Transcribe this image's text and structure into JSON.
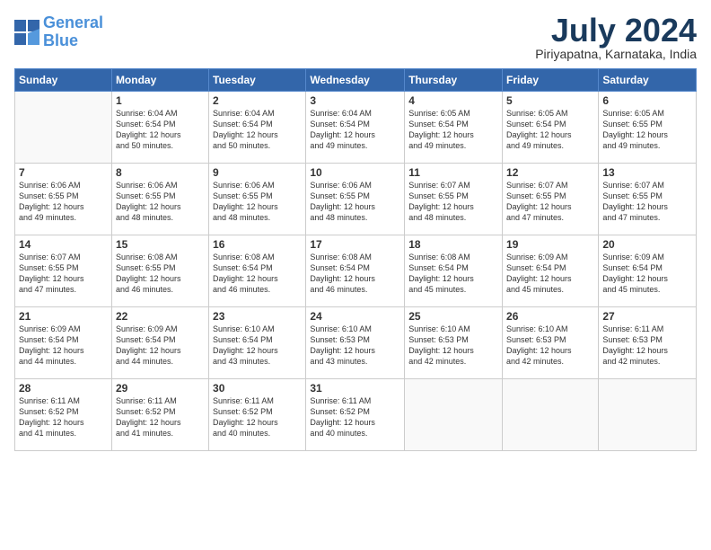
{
  "header": {
    "logo_line1": "General",
    "logo_line2": "Blue",
    "month": "July 2024",
    "location": "Piriyapatna, Karnataka, India"
  },
  "weekdays": [
    "Sunday",
    "Monday",
    "Tuesday",
    "Wednesday",
    "Thursday",
    "Friday",
    "Saturday"
  ],
  "weeks": [
    [
      {
        "day": "",
        "sunrise": "",
        "sunset": "",
        "daylight": ""
      },
      {
        "day": "1",
        "sunrise": "Sunrise: 6:04 AM",
        "sunset": "Sunset: 6:54 PM",
        "daylight": "Daylight: 12 hours and 50 minutes."
      },
      {
        "day": "2",
        "sunrise": "Sunrise: 6:04 AM",
        "sunset": "Sunset: 6:54 PM",
        "daylight": "Daylight: 12 hours and 50 minutes."
      },
      {
        "day": "3",
        "sunrise": "Sunrise: 6:04 AM",
        "sunset": "Sunset: 6:54 PM",
        "daylight": "Daylight: 12 hours and 49 minutes."
      },
      {
        "day": "4",
        "sunrise": "Sunrise: 6:05 AM",
        "sunset": "Sunset: 6:54 PM",
        "daylight": "Daylight: 12 hours and 49 minutes."
      },
      {
        "day": "5",
        "sunrise": "Sunrise: 6:05 AM",
        "sunset": "Sunset: 6:54 PM",
        "daylight": "Daylight: 12 hours and 49 minutes."
      },
      {
        "day": "6",
        "sunrise": "Sunrise: 6:05 AM",
        "sunset": "Sunset: 6:55 PM",
        "daylight": "Daylight: 12 hours and 49 minutes."
      }
    ],
    [
      {
        "day": "7",
        "sunrise": "Sunrise: 6:06 AM",
        "sunset": "Sunset: 6:55 PM",
        "daylight": "Daylight: 12 hours and 49 minutes."
      },
      {
        "day": "8",
        "sunrise": "Sunrise: 6:06 AM",
        "sunset": "Sunset: 6:55 PM",
        "daylight": "Daylight: 12 hours and 48 minutes."
      },
      {
        "day": "9",
        "sunrise": "Sunrise: 6:06 AM",
        "sunset": "Sunset: 6:55 PM",
        "daylight": "Daylight: 12 hours and 48 minutes."
      },
      {
        "day": "10",
        "sunrise": "Sunrise: 6:06 AM",
        "sunset": "Sunset: 6:55 PM",
        "daylight": "Daylight: 12 hours and 48 minutes."
      },
      {
        "day": "11",
        "sunrise": "Sunrise: 6:07 AM",
        "sunset": "Sunset: 6:55 PM",
        "daylight": "Daylight: 12 hours and 48 minutes."
      },
      {
        "day": "12",
        "sunrise": "Sunrise: 6:07 AM",
        "sunset": "Sunset: 6:55 PM",
        "daylight": "Daylight: 12 hours and 47 minutes."
      },
      {
        "day": "13",
        "sunrise": "Sunrise: 6:07 AM",
        "sunset": "Sunset: 6:55 PM",
        "daylight": "Daylight: 12 hours and 47 minutes."
      }
    ],
    [
      {
        "day": "14",
        "sunrise": "Sunrise: 6:07 AM",
        "sunset": "Sunset: 6:55 PM",
        "daylight": "Daylight: 12 hours and 47 minutes."
      },
      {
        "day": "15",
        "sunrise": "Sunrise: 6:08 AM",
        "sunset": "Sunset: 6:55 PM",
        "daylight": "Daylight: 12 hours and 46 minutes."
      },
      {
        "day": "16",
        "sunrise": "Sunrise: 6:08 AM",
        "sunset": "Sunset: 6:54 PM",
        "daylight": "Daylight: 12 hours and 46 minutes."
      },
      {
        "day": "17",
        "sunrise": "Sunrise: 6:08 AM",
        "sunset": "Sunset: 6:54 PM",
        "daylight": "Daylight: 12 hours and 46 minutes."
      },
      {
        "day": "18",
        "sunrise": "Sunrise: 6:08 AM",
        "sunset": "Sunset: 6:54 PM",
        "daylight": "Daylight: 12 hours and 45 minutes."
      },
      {
        "day": "19",
        "sunrise": "Sunrise: 6:09 AM",
        "sunset": "Sunset: 6:54 PM",
        "daylight": "Daylight: 12 hours and 45 minutes."
      },
      {
        "day": "20",
        "sunrise": "Sunrise: 6:09 AM",
        "sunset": "Sunset: 6:54 PM",
        "daylight": "Daylight: 12 hours and 45 minutes."
      }
    ],
    [
      {
        "day": "21",
        "sunrise": "Sunrise: 6:09 AM",
        "sunset": "Sunset: 6:54 PM",
        "daylight": "Daylight: 12 hours and 44 minutes."
      },
      {
        "day": "22",
        "sunrise": "Sunrise: 6:09 AM",
        "sunset": "Sunset: 6:54 PM",
        "daylight": "Daylight: 12 hours and 44 minutes."
      },
      {
        "day": "23",
        "sunrise": "Sunrise: 6:10 AM",
        "sunset": "Sunset: 6:54 PM",
        "daylight": "Daylight: 12 hours and 43 minutes."
      },
      {
        "day": "24",
        "sunrise": "Sunrise: 6:10 AM",
        "sunset": "Sunset: 6:53 PM",
        "daylight": "Daylight: 12 hours and 43 minutes."
      },
      {
        "day": "25",
        "sunrise": "Sunrise: 6:10 AM",
        "sunset": "Sunset: 6:53 PM",
        "daylight": "Daylight: 12 hours and 42 minutes."
      },
      {
        "day": "26",
        "sunrise": "Sunrise: 6:10 AM",
        "sunset": "Sunset: 6:53 PM",
        "daylight": "Daylight: 12 hours and 42 minutes."
      },
      {
        "day": "27",
        "sunrise": "Sunrise: 6:11 AM",
        "sunset": "Sunset: 6:53 PM",
        "daylight": "Daylight: 12 hours and 42 minutes."
      }
    ],
    [
      {
        "day": "28",
        "sunrise": "Sunrise: 6:11 AM",
        "sunset": "Sunset: 6:52 PM",
        "daylight": "Daylight: 12 hours and 41 minutes."
      },
      {
        "day": "29",
        "sunrise": "Sunrise: 6:11 AM",
        "sunset": "Sunset: 6:52 PM",
        "daylight": "Daylight: 12 hours and 41 minutes."
      },
      {
        "day": "30",
        "sunrise": "Sunrise: 6:11 AM",
        "sunset": "Sunset: 6:52 PM",
        "daylight": "Daylight: 12 hours and 40 minutes."
      },
      {
        "day": "31",
        "sunrise": "Sunrise: 6:11 AM",
        "sunset": "Sunset: 6:52 PM",
        "daylight": "Daylight: 12 hours and 40 minutes."
      },
      {
        "day": "",
        "sunrise": "",
        "sunset": "",
        "daylight": ""
      },
      {
        "day": "",
        "sunrise": "",
        "sunset": "",
        "daylight": ""
      },
      {
        "day": "",
        "sunrise": "",
        "sunset": "",
        "daylight": ""
      }
    ]
  ]
}
